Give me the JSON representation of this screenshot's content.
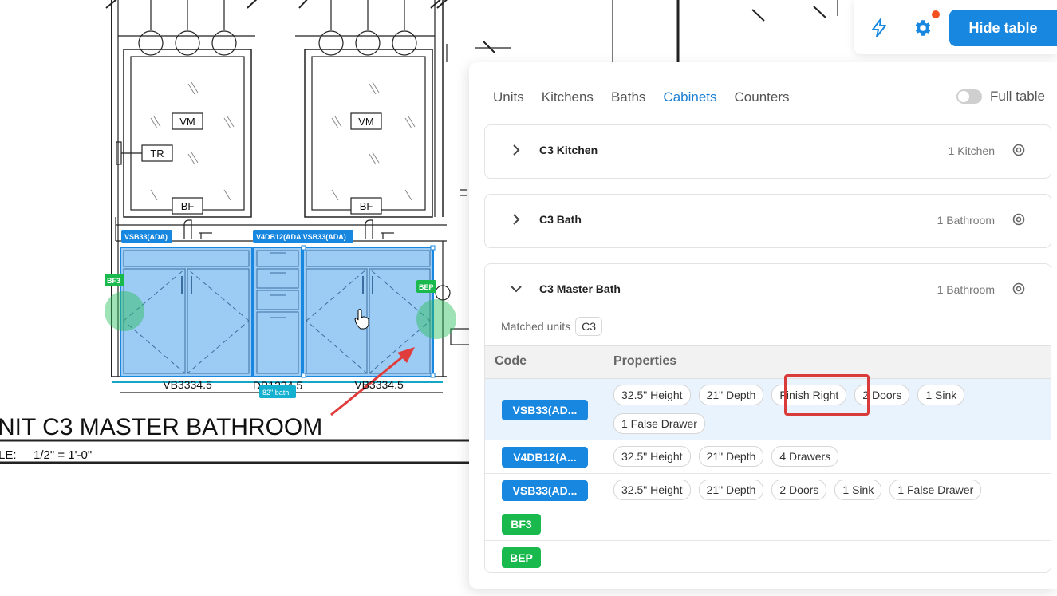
{
  "drawing": {
    "title": "NIT C3 MASTER BATHROOM",
    "scale_label": "LE:",
    "scale_value": "1/2\" = 1'-0\"",
    "mirror_label": "VM",
    "tr_label": "TR",
    "bf_label": "BF",
    "bottom_labels": [
      "VB3334.5",
      "DB1234.5",
      "VB3334.5"
    ],
    "tags": {
      "left_vanity": "VSB33(ADA)",
      "middle": "V4DB12(ADA VSB33(ADA)",
      "bf3": "BF3",
      "bep": "BEP",
      "bath_size": "82\" bath"
    }
  },
  "toolbar": {
    "bolt_icon": "lightning-icon",
    "settings_icon": "gear-icon",
    "hide_table_label": "Hide table"
  },
  "tabs": [
    {
      "label": "Units",
      "active": false
    },
    {
      "label": "Kitchens",
      "active": false
    },
    {
      "label": "Baths",
      "active": false
    },
    {
      "label": "Cabinets",
      "active": true
    },
    {
      "label": "Counters",
      "active": false
    }
  ],
  "full_table": {
    "label": "Full table",
    "on": false
  },
  "groups": [
    {
      "title": "C3 Kitchen",
      "count": "1 Kitchen",
      "expanded": false
    },
    {
      "title": "C3 Bath",
      "count": "1 Bathroom",
      "expanded": false
    },
    {
      "title": "C3 Master Bath",
      "count": "1 Bathroom",
      "expanded": true
    }
  ],
  "matched_units": {
    "label": "Matched units",
    "chip": "C3"
  },
  "table": {
    "headers": {
      "code": "Code",
      "properties": "Properties"
    },
    "rows": [
      {
        "code": "VSB33(AD...",
        "color": "#1787e0",
        "selected": true,
        "props": [
          "32.5\" Height",
          "21\" Depth",
          "Finish Right",
          "2 Doors",
          "1 Sink",
          "1 False Drawer"
        ]
      },
      {
        "code": "V4DB12(A...",
        "color": "#1787e0",
        "selected": false,
        "props": [
          "32.5\" Height",
          "21\" Depth",
          "4 Drawers"
        ]
      },
      {
        "code": "VSB33(AD...",
        "color": "#1787e0",
        "selected": false,
        "props": [
          "32.5\" Height",
          "21\" Depth",
          "2 Doors",
          "1 Sink",
          "1 False Drawer"
        ]
      },
      {
        "code": "BF3",
        "color": "#19b94e",
        "selected": false,
        "props": []
      },
      {
        "code": "BEP",
        "color": "#19b94e",
        "selected": false,
        "props": []
      }
    ]
  },
  "colors": {
    "accent": "#1787e0",
    "green": "#19b94e",
    "highlight": "#d93a3a",
    "notification": "#f4511e"
  }
}
